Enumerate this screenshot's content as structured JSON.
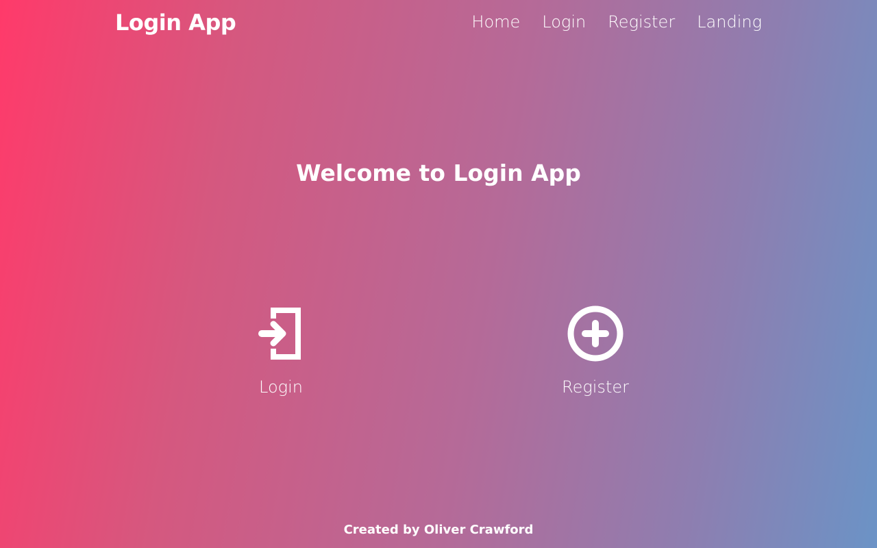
{
  "header": {
    "brand": "Login App",
    "nav": [
      "Home",
      "Login",
      "Register",
      "Landing"
    ]
  },
  "main": {
    "title": "Welcome to Login App",
    "actions": [
      {
        "label": "Login",
        "icon": "login-icon"
      },
      {
        "label": "Register",
        "icon": "plus-circle-icon"
      }
    ]
  },
  "footer": {
    "text": "Created by Oliver Crawford"
  },
  "colors": {
    "gradient_start": "#ff3a6a",
    "gradient_end": "#6b93c6",
    "text": "#ffffff"
  }
}
